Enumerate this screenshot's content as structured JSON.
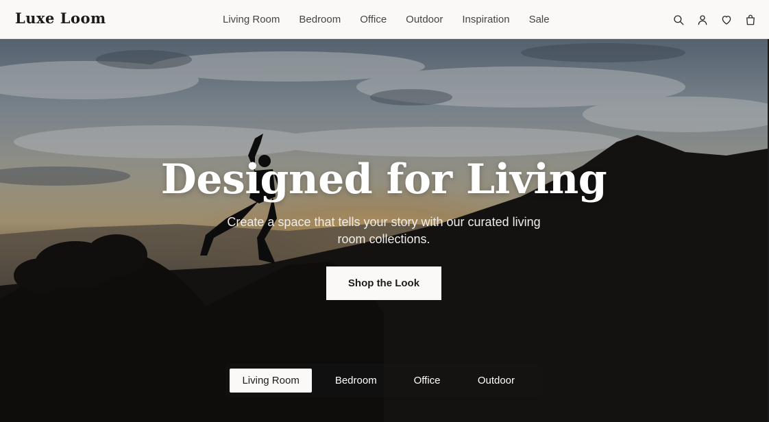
{
  "header": {
    "logo": "Luxe Loom",
    "nav": [
      {
        "label": "Living Room"
      },
      {
        "label": "Bedroom"
      },
      {
        "label": "Office"
      },
      {
        "label": "Outdoor"
      },
      {
        "label": "Inspiration"
      },
      {
        "label": "Sale"
      }
    ],
    "icons": [
      "search-icon",
      "user-icon",
      "heart-icon",
      "shopping-bag-icon"
    ]
  },
  "hero": {
    "title": "Designed for Living",
    "subtitle": "Create a space that tells your story with our curated living room collections.",
    "cta_label": "Shop the Look"
  },
  "room_tabs": {
    "active_index": 0,
    "items": [
      {
        "label": "Living Room"
      },
      {
        "label": "Bedroom"
      },
      {
        "label": "Office"
      },
      {
        "label": "Outdoor"
      }
    ]
  },
  "colors": {
    "header_bg": "#faf9f7",
    "text_dark": "#1b1b1b",
    "hero_text": "#ffffff"
  }
}
